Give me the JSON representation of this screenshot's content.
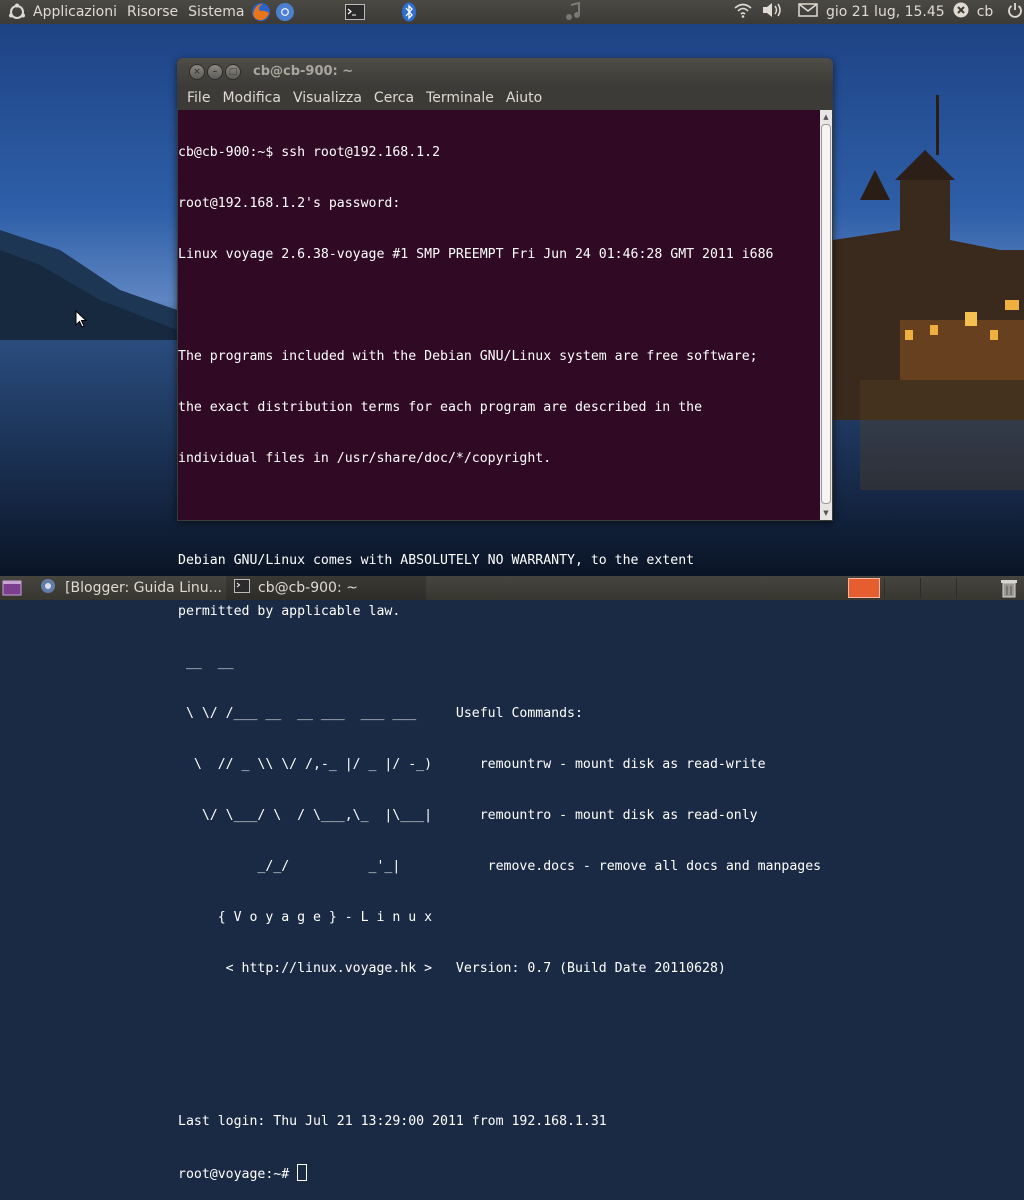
{
  "top_panel": {
    "menus": [
      "Applicazioni",
      "Risorse",
      "Sistema"
    ],
    "launchers": [
      "firefox-icon",
      "chromium-icon",
      "terminal-icon",
      "bluetooth-icon",
      "music-icon"
    ],
    "clock": "gio 21 lug, 15.45",
    "user": "cb",
    "tray_icons": [
      "network-icon",
      "volume-icon",
      "mail-icon",
      "status-icon",
      "power-icon"
    ]
  },
  "window": {
    "title": "cb@cb-900: ~",
    "menu": [
      "File",
      "Modifica",
      "Visualizza",
      "Cerca",
      "Terminale",
      "Aiuto"
    ]
  },
  "terminal": {
    "background": "#300a24",
    "lines": [
      "cb@cb-900:~$ ssh root@192.168.1.2",
      "root@192.168.1.2's password:",
      "Linux voyage 2.6.38-voyage #1 SMP PREEMPT Fri Jun 24 01:46:28 GMT 2011 i686",
      "",
      "The programs included with the Debian GNU/Linux system are free software;",
      "the exact distribution terms for each program are described in the",
      "individual files in /usr/share/doc/*/copyright.",
      "",
      "Debian GNU/Linux comes with ABSOLUTELY NO WARRANTY, to the extent",
      "permitted by applicable law.",
      " __  __",
      " \\ \\/ /___ __  __ ___  ___ ___     Useful Commands:",
      "  \\  // _ \\\\ \\/ /,-_ |/ _ |/ -_)      remountrw - mount disk as read-write",
      "   \\/ \\___/ \\  / \\___,\\_  |\\___|      remountro - mount disk as read-only",
      "          _/_/          _'_|           remove.docs - remove all docs and manpages",
      "     { V o y a g e } - L i n u x",
      "      < http://linux.voyage.hk >   Version: 0.7 (Build Date 20110628)",
      "",
      "",
      "Last login: Thu Jul 21 13:29:00 2011 from 192.168.1.31"
    ],
    "prompt": "root@voyage:~# "
  },
  "bottom_panel": {
    "tasks": [
      {
        "label": "[Blogger: Guida Linu...",
        "icon": "chromium-icon"
      },
      {
        "label": "cb@cb-900: ~",
        "icon": "terminal-icon"
      }
    ],
    "workspaces": 4,
    "active_workspace": 1
  }
}
